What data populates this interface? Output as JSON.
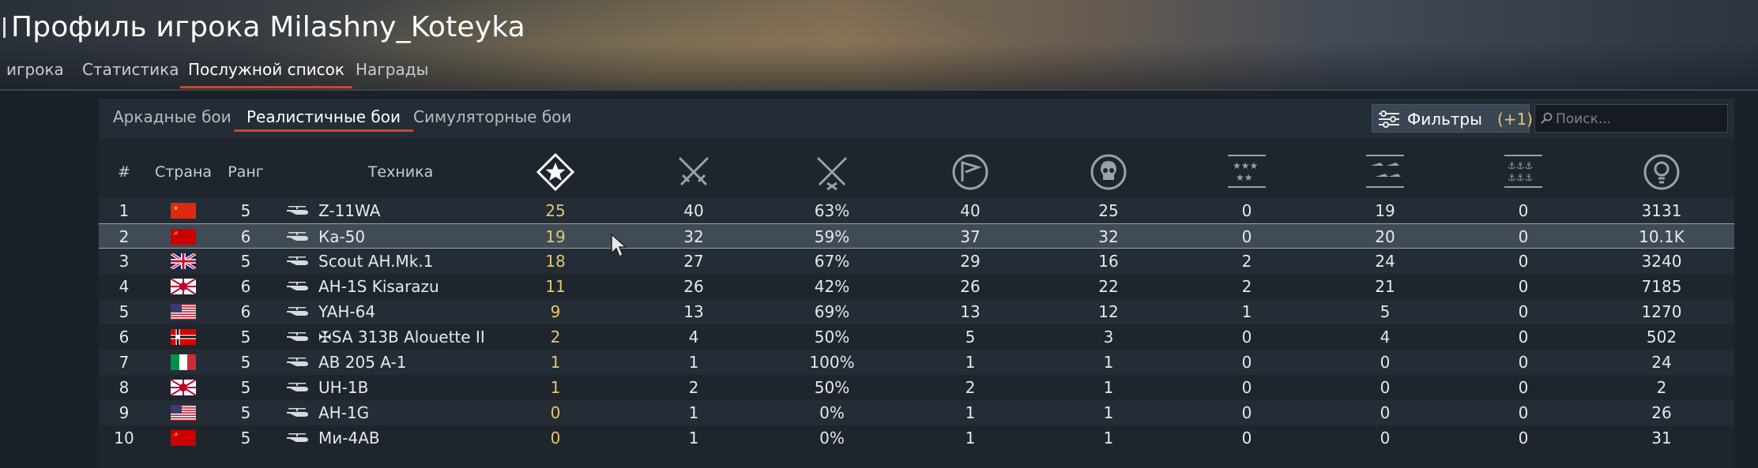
{
  "title": "Профиль игрока Milashny_Koteyka",
  "top_tabs": [
    "игрока",
    "Статистика",
    "Послужной список",
    "Награды"
  ],
  "active_top_tab": 2,
  "sub_tabs": [
    "Аркадные бои",
    "Реалистичные бои",
    "Симуляторные бои"
  ],
  "active_sub_tab": 1,
  "filters": {
    "label": "Фильтры",
    "count": "(+1)"
  },
  "search": {
    "placeholder": "Поиск..."
  },
  "columns": {
    "num": "#",
    "country": "Страна",
    "rank": "Ранг",
    "vehicle": "Техника",
    "icons": [
      "battles-star-icon",
      "crossed-swords-icon",
      "crossed-swords-x-icon",
      "flag-circle-icon",
      "skull-circle-icon",
      "stars-grid-icon",
      "aircraft-kills-icon",
      "naval-kills-icon",
      "lightbulb-circle-icon"
    ]
  },
  "accent_colors": {
    "highlight": "#e8c56a",
    "underline": "#c9472a"
  },
  "rows": [
    {
      "n": "1",
      "flag": "china",
      "rank": "5",
      "vehicle": "Z-11WA",
      "c1": "25",
      "c2": "40",
      "c3": "63%",
      "c4": "40",
      "c5": "25",
      "c6": "0",
      "c7": "19",
      "c8": "0",
      "c9": "3131"
    },
    {
      "n": "2",
      "flag": "ussr",
      "rank": "6",
      "vehicle": "Ка-50",
      "c1": "19",
      "c2": "32",
      "c3": "59%",
      "c4": "37",
      "c5": "32",
      "c6": "0",
      "c7": "20",
      "c8": "0",
      "c9": "10.1K"
    },
    {
      "n": "3",
      "flag": "uk",
      "rank": "5",
      "vehicle": "Scout AH.Mk.1",
      "c1": "18",
      "c2": "27",
      "c3": "67%",
      "c4": "29",
      "c5": "16",
      "c6": "2",
      "c7": "24",
      "c8": "0",
      "c9": "3240"
    },
    {
      "n": "4",
      "flag": "japan",
      "rank": "6",
      "vehicle": "AH-1S Kisarazu",
      "c1": "11",
      "c2": "26",
      "c3": "42%",
      "c4": "26",
      "c5": "22",
      "c6": "2",
      "c7": "21",
      "c8": "0",
      "c9": "7185"
    },
    {
      "n": "5",
      "flag": "usa",
      "rank": "6",
      "vehicle": "YAH-64",
      "c1": "9",
      "c2": "13",
      "c3": "69%",
      "c4": "13",
      "c5": "12",
      "c6": "1",
      "c7": "5",
      "c8": "0",
      "c9": "1270"
    },
    {
      "n": "6",
      "flag": "germany",
      "rank": "5",
      "vehicle": "✠SA 313B Alouette II",
      "c1": "2",
      "c2": "4",
      "c3": "50%",
      "c4": "5",
      "c5": "3",
      "c6": "0",
      "c7": "4",
      "c8": "0",
      "c9": "502"
    },
    {
      "n": "7",
      "flag": "italy",
      "rank": "5",
      "vehicle": "AB 205 A-1",
      "c1": "1",
      "c2": "1",
      "c3": "100%",
      "c4": "1",
      "c5": "1",
      "c6": "0",
      "c7": "0",
      "c8": "0",
      "c9": "24"
    },
    {
      "n": "8",
      "flag": "japan",
      "rank": "5",
      "vehicle": "UH-1B",
      "c1": "1",
      "c2": "2",
      "c3": "50%",
      "c4": "2",
      "c5": "1",
      "c6": "0",
      "c7": "0",
      "c8": "0",
      "c9": "2"
    },
    {
      "n": "9",
      "flag": "usa",
      "rank": "5",
      "vehicle": "AH-1G",
      "c1": "0",
      "c2": "1",
      "c3": "0%",
      "c4": "1",
      "c5": "1",
      "c6": "0",
      "c7": "0",
      "c8": "0",
      "c9": "26"
    },
    {
      "n": "10",
      "flag": "ussr",
      "rank": "5",
      "vehicle": "Ми-4АВ",
      "c1": "0",
      "c2": "1",
      "c3": "0%",
      "c4": "1",
      "c5": "1",
      "c6": "0",
      "c7": "0",
      "c8": "0",
      "c9": "31"
    }
  ],
  "selected_row": 1
}
